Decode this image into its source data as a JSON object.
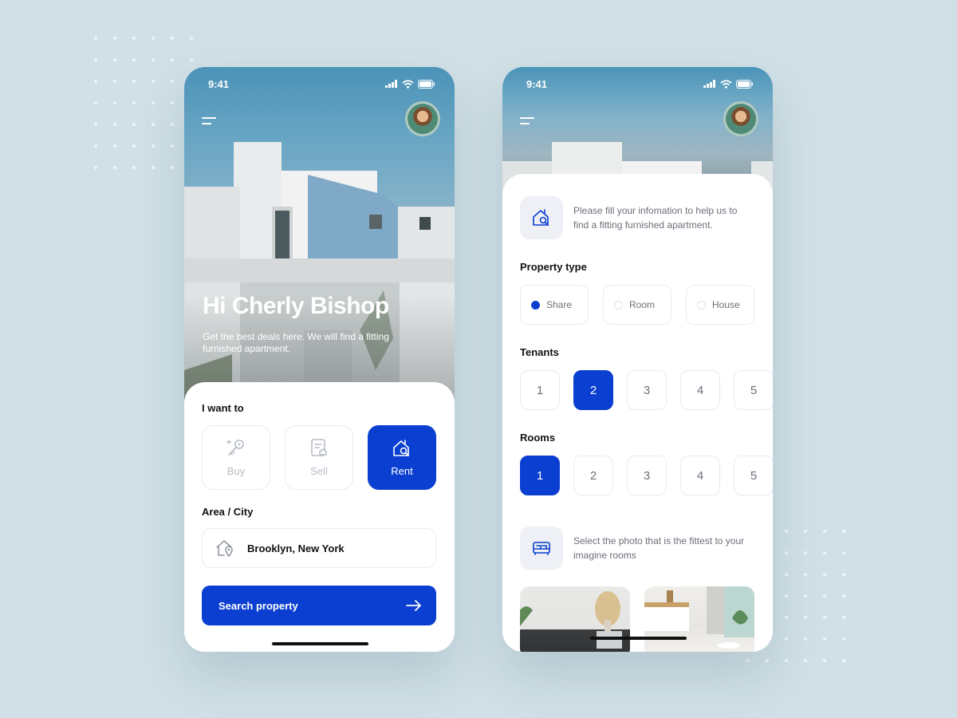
{
  "status_time": "9:41",
  "screen1": {
    "greeting": "Hi Cherly Bishop",
    "subtitle": "Get the best deals here. We will find a fitting furnished apartment.",
    "want_label": "I want to",
    "options": [
      {
        "label": "Buy",
        "icon": "key-icon"
      },
      {
        "label": "Sell",
        "icon": "document-icon"
      },
      {
        "label": "Rent",
        "icon": "house-search-icon",
        "active": true
      }
    ],
    "area_label": "Area / City",
    "city_value": "Brooklyn, New York",
    "search_label": "Search property"
  },
  "screen2": {
    "info_text": "Please fill your infomation to help us to find a fitting furnished apartment.",
    "property_type_label": "Property type",
    "property_types": [
      {
        "label": "Share",
        "selected": true
      },
      {
        "label": "Room",
        "selected": false
      },
      {
        "label": "House",
        "selected": false
      }
    ],
    "tenants_label": "Tenants",
    "tenants": [
      "1",
      "2",
      "3",
      "4",
      "5"
    ],
    "tenants_selected": "2",
    "rooms_label": "Rooms",
    "rooms": [
      "1",
      "2",
      "3",
      "4",
      "5"
    ],
    "rooms_selected": "1",
    "photo_text": "Select the photo that is the fittest to your imagine rooms"
  },
  "colors": {
    "accent": "#0a3fd1",
    "background": "#d0e0e6"
  }
}
